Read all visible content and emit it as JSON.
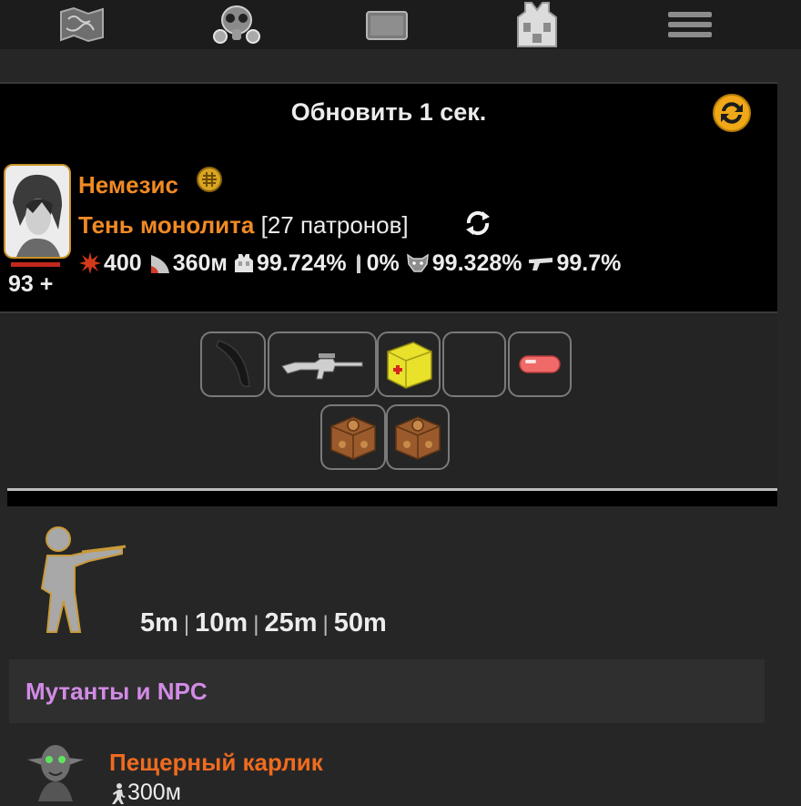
{
  "nav": {
    "items": [
      {
        "name": "map-icon"
      },
      {
        "name": "gasmask-icon"
      },
      {
        "name": "backpack-icon"
      },
      {
        "name": "armor-vest-icon"
      },
      {
        "name": "menu-icon"
      }
    ]
  },
  "refresh": {
    "label": "Обновить 1 сек."
  },
  "player": {
    "name": "Немезис",
    "hp": "93 +",
    "clan": "Тень монолита",
    "ammo": "[27 патронов]",
    "stats": {
      "damage": "400",
      "range": "360м",
      "armor": "99.724%",
      "ammo_pct": "0%",
      "wolf_pct": "99.328%",
      "gun_pct": "99.7%"
    }
  },
  "equipment": {
    "slots": [
      {
        "item": "knife-icon"
      },
      {
        "item": "rifle-icon"
      },
      {
        "item": "medkit-icon"
      },
      {
        "item": ""
      },
      {
        "item": "pill-icon"
      },
      {
        "item": "crate-icon"
      },
      {
        "item": "crate-icon"
      }
    ]
  },
  "range": {
    "r1": "5m",
    "r2": "10m",
    "r3": "25m",
    "r4": "50m",
    "sep": "|"
  },
  "mutants": {
    "title": "Мутанты и NPC"
  },
  "enemy": {
    "name": "Пещерный карлик",
    "distance": "300м"
  },
  "colors": {
    "accent": "#f08a24",
    "npc_header": "#d28be6",
    "enemy": "#ef6b1f",
    "hp": "#c0281e"
  }
}
